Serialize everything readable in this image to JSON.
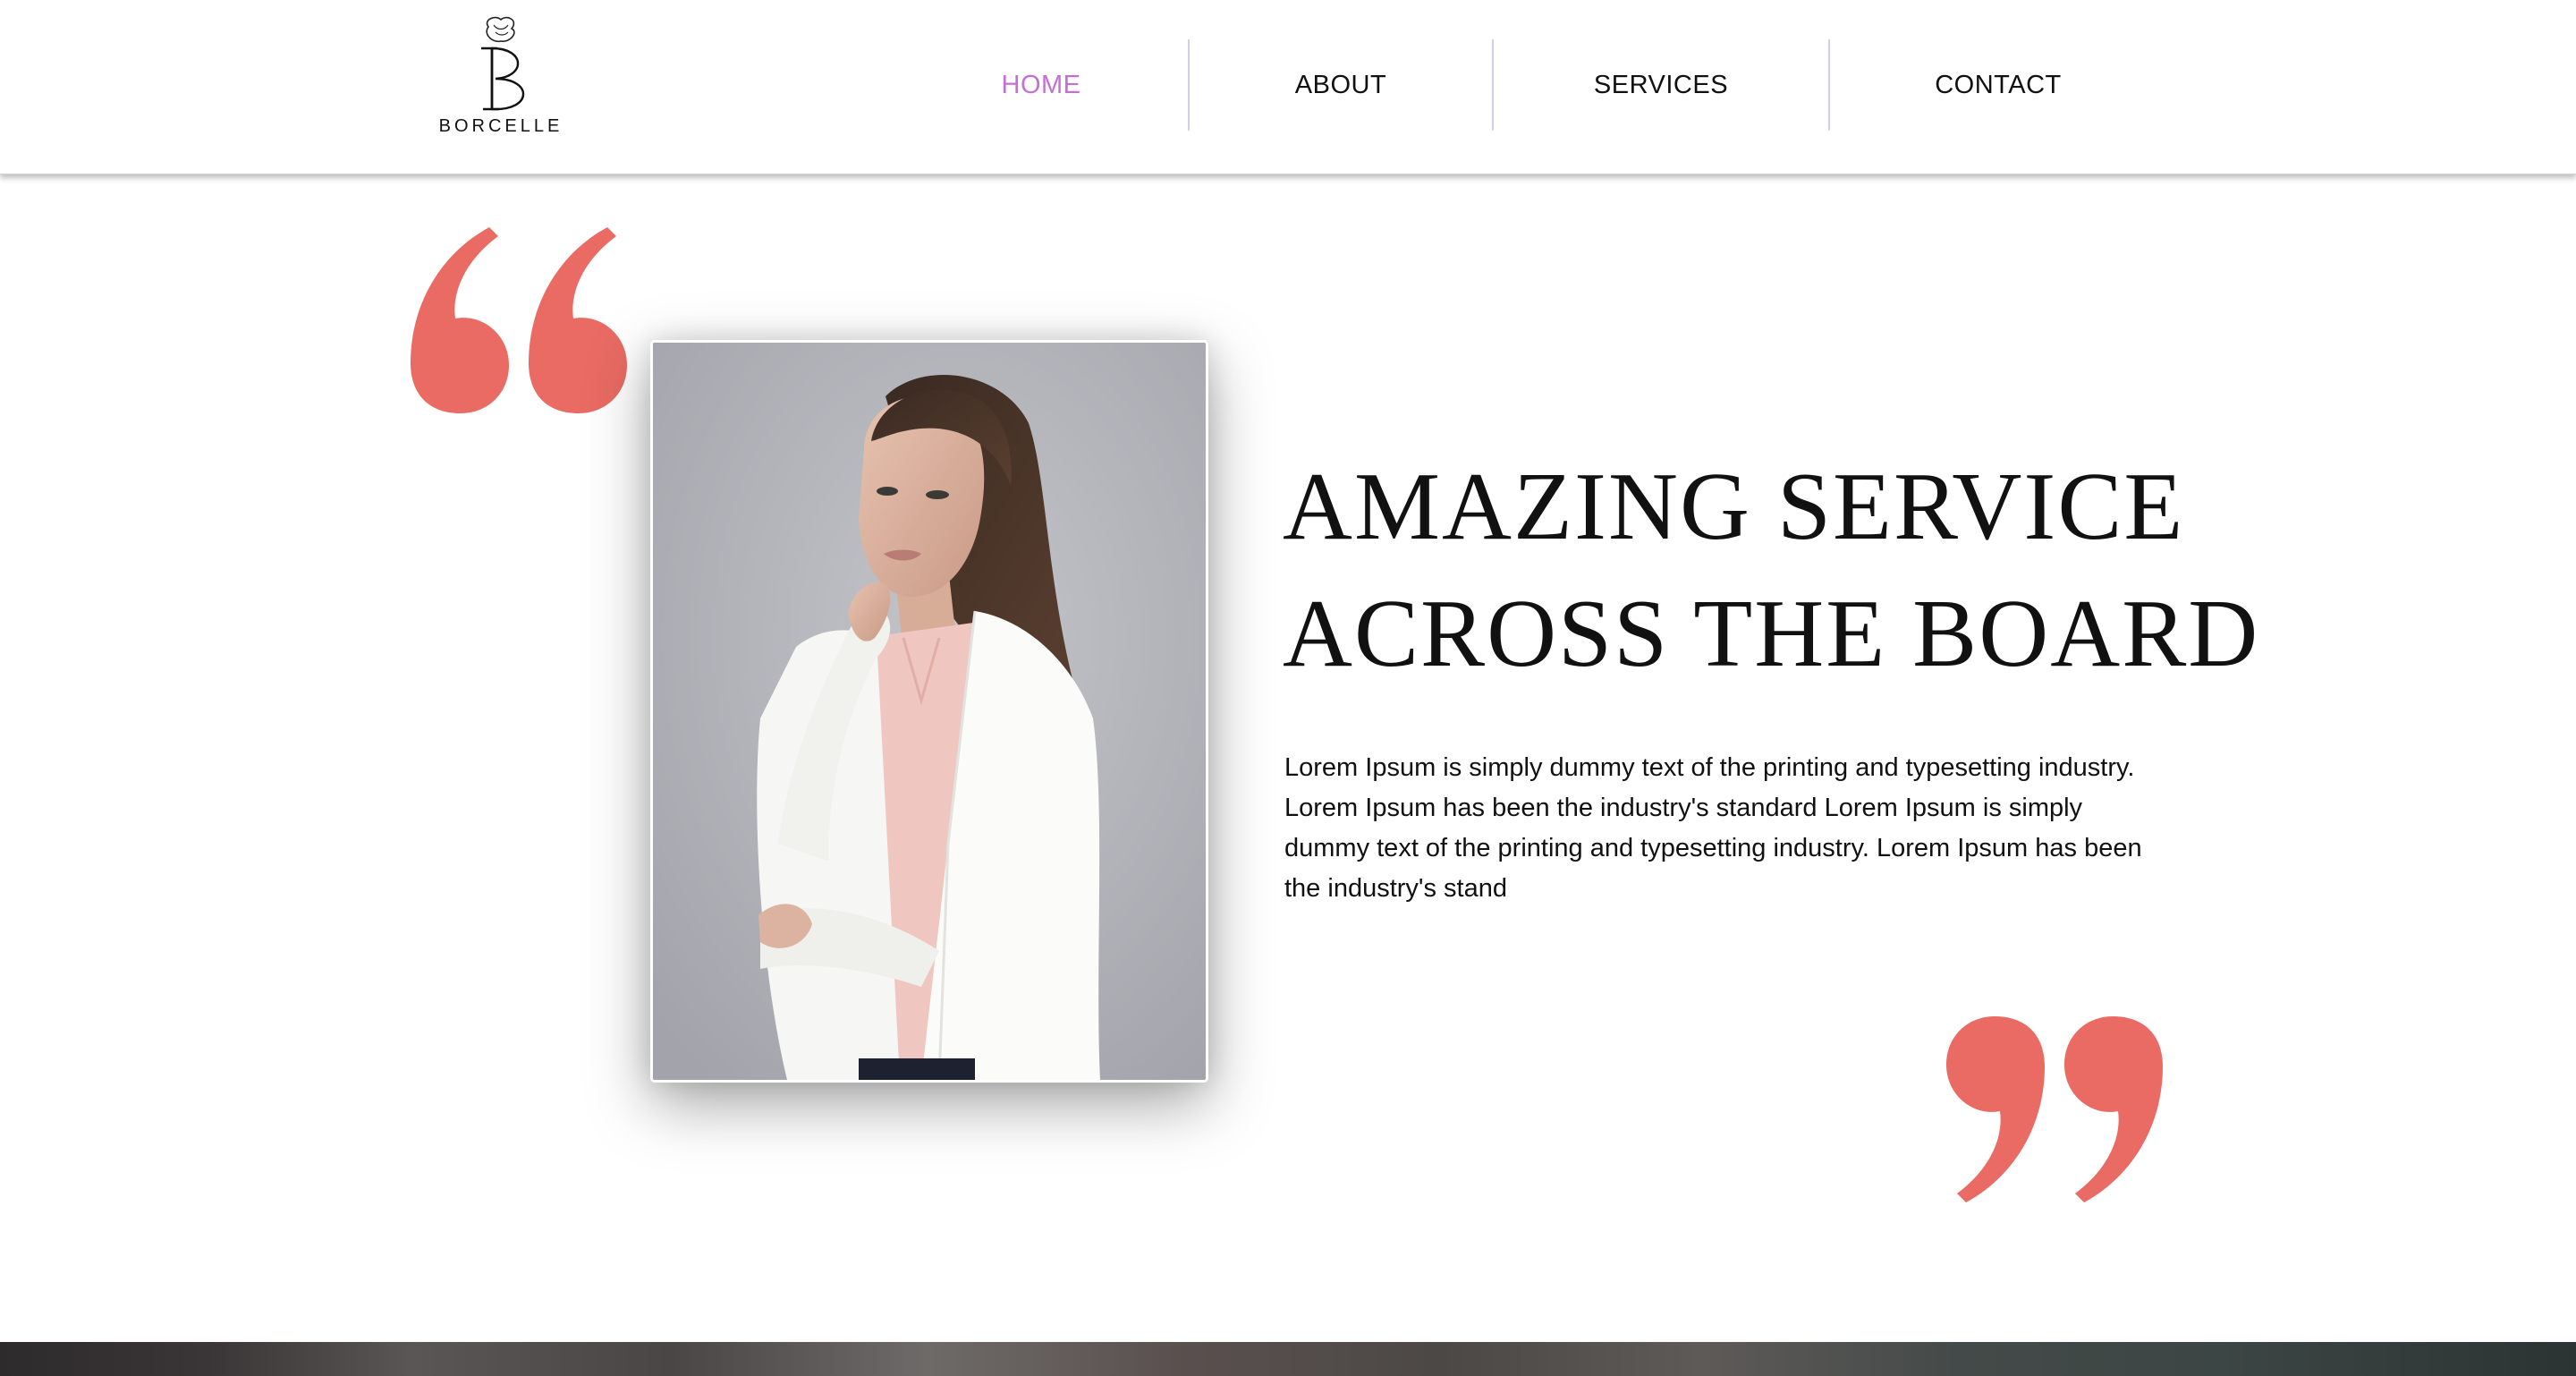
{
  "header": {
    "logo": {
      "text": "BORCELLE",
      "icon": "rose-monogram-logo"
    },
    "nav": {
      "items": [
        {
          "label": "HOME",
          "active": true
        },
        {
          "label": "ABOUT",
          "active": false
        },
        {
          "label": "SERVICES",
          "active": false
        },
        {
          "label": "CONTACT",
          "active": false
        }
      ]
    }
  },
  "main": {
    "headline": {
      "line1": "AMAZING SERVICE",
      "line2": "ACROSS THE BOARD"
    },
    "body": "Lorem Ipsum is simply dummy text of the printing and typesetting industry. Lorem Ipsum has been the industry's standard Lorem Ipsum is simply dummy text of the printing and typesetting industry. Lorem Ipsum has been the industry's stand",
    "photo": {
      "subject": "woman-in-white-blazer-portrait"
    },
    "quote_icons": [
      "open-quote-icon",
      "close-quote-icon"
    ]
  },
  "colors": {
    "accent_active_nav": "#c56fd6",
    "quote_mark": "#e96b63",
    "text": "#111111",
    "nav_separator": "#cfcfe6"
  }
}
